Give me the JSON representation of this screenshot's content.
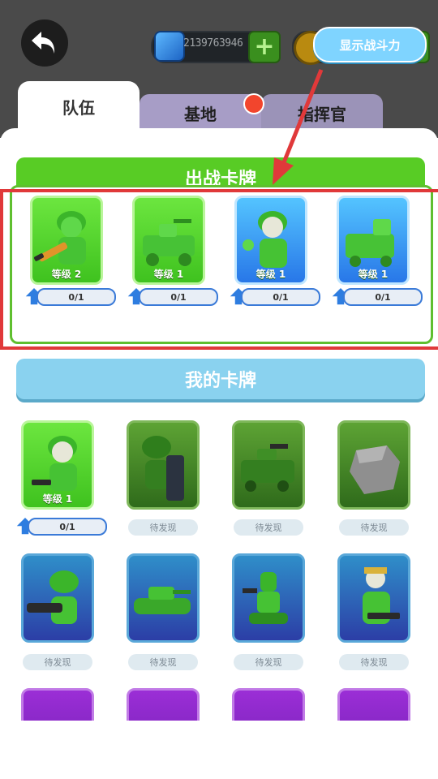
{
  "header": {
    "gems_value": "2139763946",
    "power_button": "显示战斗力"
  },
  "tabs": [
    {
      "label": "队伍"
    },
    {
      "label": "基地"
    },
    {
      "label": "指挥官"
    }
  ],
  "battle_deck": {
    "title": "出战卡牌",
    "cards": [
      {
        "level": "等级 2",
        "progress": "0/1",
        "kind": "soldier-rifle",
        "color": "green"
      },
      {
        "level": "等级 1",
        "progress": "0/1",
        "kind": "jeep",
        "color": "green"
      },
      {
        "level": "等级 1",
        "progress": "0/1",
        "kind": "soldier-wave",
        "color": "blue"
      },
      {
        "level": "等级 1",
        "progress": "0/1",
        "kind": "truck",
        "color": "blue"
      }
    ]
  },
  "my_cards": {
    "title": "我的卡牌",
    "row1": [
      {
        "level": "等级 1",
        "progress": "0/1",
        "kind": "soldier-pistol"
      },
      {
        "status": "待发现",
        "kind": "shield-soldier"
      },
      {
        "status": "待发现",
        "kind": "armored-car"
      },
      {
        "status": "待发现",
        "kind": "rock"
      }
    ],
    "row2": [
      {
        "status": "待发现",
        "kind": "bazooka-soldier"
      },
      {
        "status": "待发现",
        "kind": "tank"
      },
      {
        "status": "待发现",
        "kind": "robot-tread"
      },
      {
        "status": "待发现",
        "kind": "gunner-soldier"
      }
    ]
  },
  "colors": {
    "accent_green": "#58cc25",
    "accent_blue": "#8ad2ef",
    "highlight_red": "#e0393a"
  }
}
